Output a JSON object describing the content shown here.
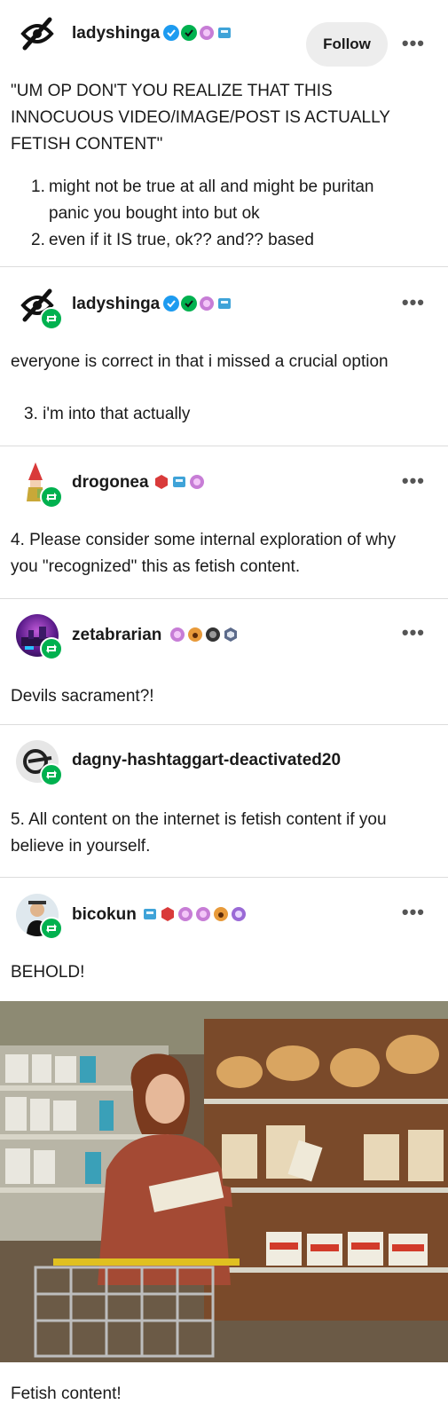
{
  "posts": [
    {
      "username": "ladyshinga",
      "follow_label": "Follow",
      "more": "•••",
      "body_lines": [
        "\"UM OP DON'T YOU REALIZE THAT THIS",
        "INNOCUOUS VIDEO/IMAGE/POST IS ACTUALLY",
        "FETISH CONTENT\""
      ],
      "list": [
        {
          "num": "1.",
          "lines": [
            "might not be true at all and might be puritan",
            "panic you bought into but ok"
          ]
        },
        {
          "num": "2.",
          "lines": [
            "even if it IS true, ok?? and?? based"
          ]
        }
      ]
    },
    {
      "username": "ladyshinga",
      "more": "•••",
      "body": "everyone is correct in that i missed a crucial option",
      "list_item": "3. i'm into that actually"
    },
    {
      "username": "drogonea",
      "more": "•••",
      "body_lines": [
        "4. Please consider some internal exploration of why",
        "you \"recognized\" this as fetish content."
      ]
    },
    {
      "username": "zetabrarian",
      "more": "•••",
      "body": "Devils sacrament?!"
    },
    {
      "username": "dagny-hashtaggart-deactivated20",
      "body_lines": [
        "5. All content on the internet is fetish content if you",
        "believe in yourself."
      ]
    },
    {
      "username": "bicokun",
      "more": "•••",
      "body": "BEHOLD!",
      "caption": "Fetish content!"
    }
  ],
  "colors": {
    "reblog_green": "#00b14f",
    "verified_blue": "#1d9bf0",
    "check_green": "#00b14f",
    "divider": "#dcdcdc",
    "follow_bg": "#ededed"
  },
  "icons": [
    "eye-slash-icon",
    "reblog-icon",
    "more-icon",
    "verified-badge-icon"
  ]
}
